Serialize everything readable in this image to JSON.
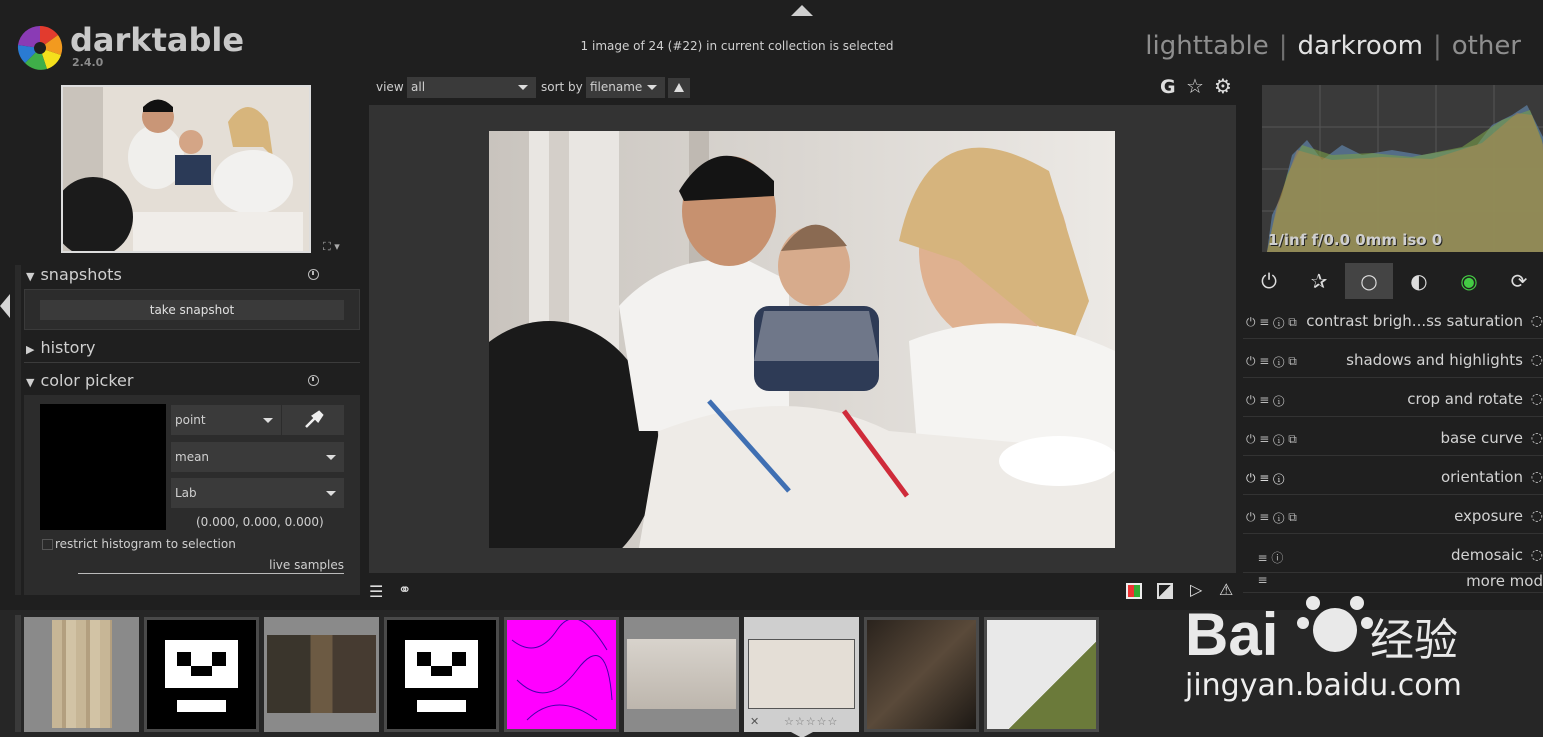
{
  "app": {
    "name": "darktable",
    "version": "2.4.0"
  },
  "header": {
    "status": "1 image of 24 (#22) in current collection is selected"
  },
  "views": {
    "lighttable": "lighttable",
    "darkroom": "darkroom",
    "other": "other",
    "separator": "|"
  },
  "left_panel": {
    "snapshots": {
      "title": "snapshots",
      "button": "take snapshot"
    },
    "history": {
      "title": "history"
    },
    "color_picker": {
      "title": "color picker",
      "mode": "point",
      "stat": "mean",
      "colorspace": "Lab",
      "values": "(0.000, 0.000, 0.000)",
      "restrict_label": "restrict histogram to selection",
      "live_samples": "live samples"
    }
  },
  "top_toolbar": {
    "view_label": "view",
    "view_value": "all",
    "sort_label": "sort by",
    "sort_value": "filename",
    "g_icon": "G"
  },
  "histogram": {
    "exif": "1/inf f/0.0 0mm iso 0"
  },
  "module_groups": [
    "power-icon",
    "star-icon",
    "circle-icon",
    "sphere-icon",
    "color-icon",
    "rotate-icon"
  ],
  "modules": [
    {
      "name": "contrast brigh...ss saturation",
      "icon": "power-icon"
    },
    {
      "name": "shadows and highlights",
      "icon": "power-icon"
    },
    {
      "name": "crop and rotate",
      "icon": "power-icon"
    },
    {
      "name": "base curve",
      "icon": "power-icon"
    },
    {
      "name": "orientation",
      "icon": "power-icon"
    },
    {
      "name": "exposure",
      "icon": "power-icon"
    },
    {
      "name": "demosaic",
      "icon": "power-icon"
    },
    {
      "name": "more mod",
      "icon": "menu-icon"
    }
  ],
  "filmstrip": {
    "count": 9,
    "selected_index": 6,
    "rating_stars": "☆☆☆☆☆",
    "reject": "✕"
  },
  "watermark": {
    "text": "jingyan.baidu.com",
    "brand": "Bai",
    "cn": "经验"
  },
  "colors": {
    "bg": "#1f1f1f",
    "panel": "#2c2c2c",
    "accent": "#cfcfcf"
  }
}
